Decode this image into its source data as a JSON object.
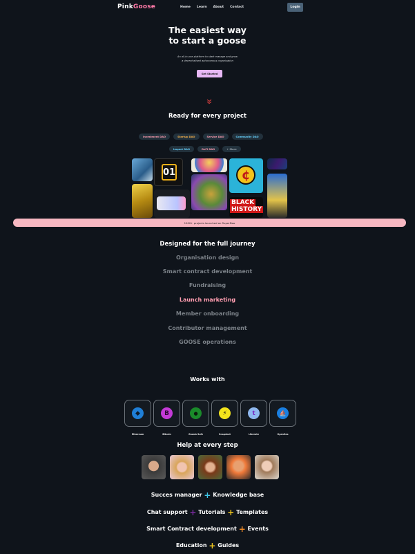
{
  "nav": {
    "logo_a": "Pink",
    "logo_b": "Goose",
    "links": [
      "Home",
      "Learn",
      "About",
      "Contact"
    ],
    "login": "Login"
  },
  "hero": {
    "title_line1": "The easiest way",
    "title_line2": "to start a goose",
    "subtitle_line1": "An all-in-one platform to start manage and grow",
    "subtitle_line2": "a decentralised autonomous organisation",
    "cta": "Get Started"
  },
  "projects": {
    "title": "Ready for every project",
    "chips_row1": [
      "Investment DAO",
      "Startup DAO",
      "Service DAO",
      "Community DAO"
    ],
    "chips_row2": [
      "Impact DAO",
      "DeFi DAO",
      "+ More"
    ],
    "chip_colors": {
      "Investment DAO": "#ff9db0",
      "Startup DAO": "#f6b04a",
      "Service DAO": "#ff9db0",
      "Community DAO": "#67d3ff",
      "Impact DAO": "#67d3ff",
      "DeFi DAO": "#ff9db0",
      "+ More": "#9aa3ab"
    },
    "banner": "1000+ projects launched on SuperDao",
    "gallery_text": {
      "tile_number": "01",
      "black_history_1": "BLACK",
      "black_history_2": "HISTORY",
      "cent": "¢"
    }
  },
  "journey": {
    "title": "Designed for the full journey",
    "items": [
      "Organisation design",
      "Smart contract development",
      "Fundraising",
      "Launch marketing",
      "Member onboarding",
      "Contributor management",
      "GOOSE operations"
    ],
    "active_index": 3
  },
  "works": {
    "title": "Works with",
    "wallets": [
      {
        "name": "Ethereum",
        "icon": "ethereum-icon",
        "bg": "#1f7fd6",
        "glyph": "◆"
      },
      {
        "name": "Bitcoin",
        "icon": "bitcoin-icon",
        "bg": "#c23ad6",
        "glyph": "B"
      },
      {
        "name": "Gnosis Safe",
        "icon": "gnosis-safe-icon",
        "bg": "#1a8a2a",
        "glyph": "●"
      },
      {
        "name": "Snapshot",
        "icon": "snapshot-icon",
        "bg": "#f3e41c",
        "glyph": "⚡"
      },
      {
        "name": "Liberate",
        "icon": "liberate-icon",
        "bg": "#8fb8ef",
        "glyph": "t"
      },
      {
        "name": "OpenSea",
        "icon": "opensea-icon",
        "bg": "#1a7fe0",
        "glyph": "⛵"
      }
    ]
  },
  "help": {
    "title": "Help at every step",
    "features": [
      {
        "parts": [
          "Succes manager",
          "Knowledge base"
        ],
        "plus_colors": [
          "#3ec4e6"
        ]
      },
      {
        "parts": [
          "Chat support",
          "Tutorials",
          "Templates"
        ],
        "plus_colors": [
          "#7a2aa0",
          "#f2c81e"
        ]
      },
      {
        "parts": [
          "Smart Contract development",
          "Events"
        ],
        "plus_colors": [
          "#f08a24"
        ]
      },
      {
        "parts": [
          "Education",
          "Guides"
        ],
        "plus_colors": [
          "#f2c81e"
        ]
      }
    ]
  }
}
